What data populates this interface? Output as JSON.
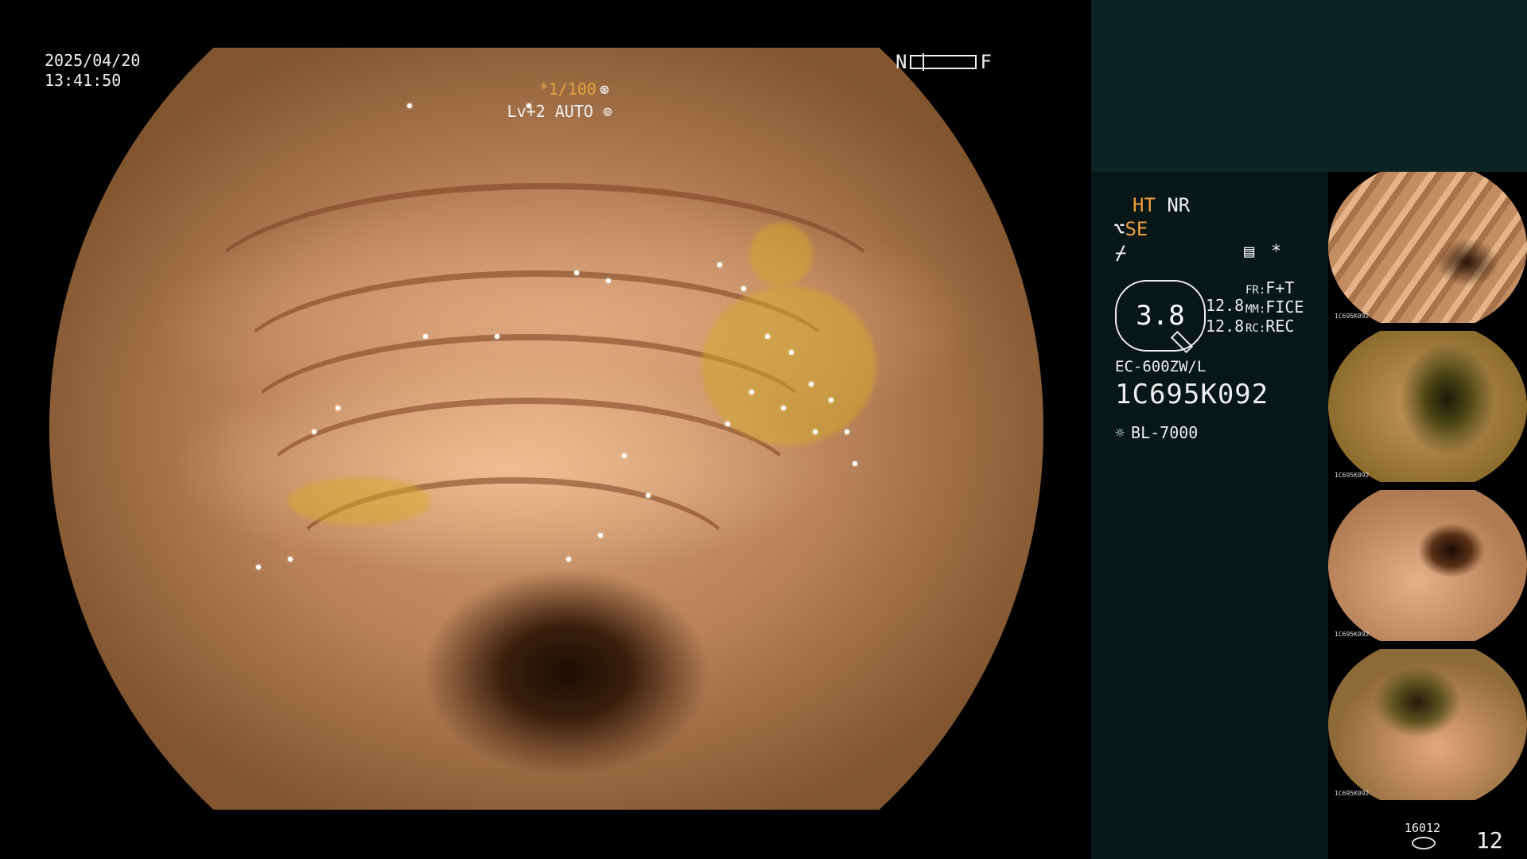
{
  "overlay": {
    "date": "2025/04/20",
    "time": "13:41:50",
    "nf_left": "N",
    "nf_right": "F",
    "shutter": "*1/100",
    "shutter_icon": "aperture-icon",
    "level": "Lv+2 AUTO",
    "level_icon": "iris-icon"
  },
  "side": {
    "ht": "HT",
    "nr": "NR",
    "se": "SE",
    "misc_symbol": "⌿",
    "menu_icon": "menu-icon",
    "asterisk": "*",
    "gauge_value": "3.8",
    "val_1": "12.8",
    "val_2": "12.8",
    "fr_label": "FR:",
    "fr_value": "F+T",
    "mm_label": "MM:",
    "mm_value": "FICE",
    "rc_label": "RC:",
    "rc_value": "REC",
    "scope_model": "EC-600ZW/L",
    "scope_serial": "1C695K092",
    "light_source": "BL-7000",
    "light_icon": "lamp-icon"
  },
  "thumbnails": [
    {
      "label": "1C695K092"
    },
    {
      "label": "1C695K092"
    },
    {
      "label": "1C695K092"
    },
    {
      "label": "1C695K092"
    }
  ],
  "footer": {
    "counter_small": "16012",
    "counter_big": "12",
    "disk_icon": "disk-icon"
  },
  "colors": {
    "accent_orange": "#f0a03a",
    "panel_teal": "#0c2424",
    "panel_dark": "#071616"
  }
}
